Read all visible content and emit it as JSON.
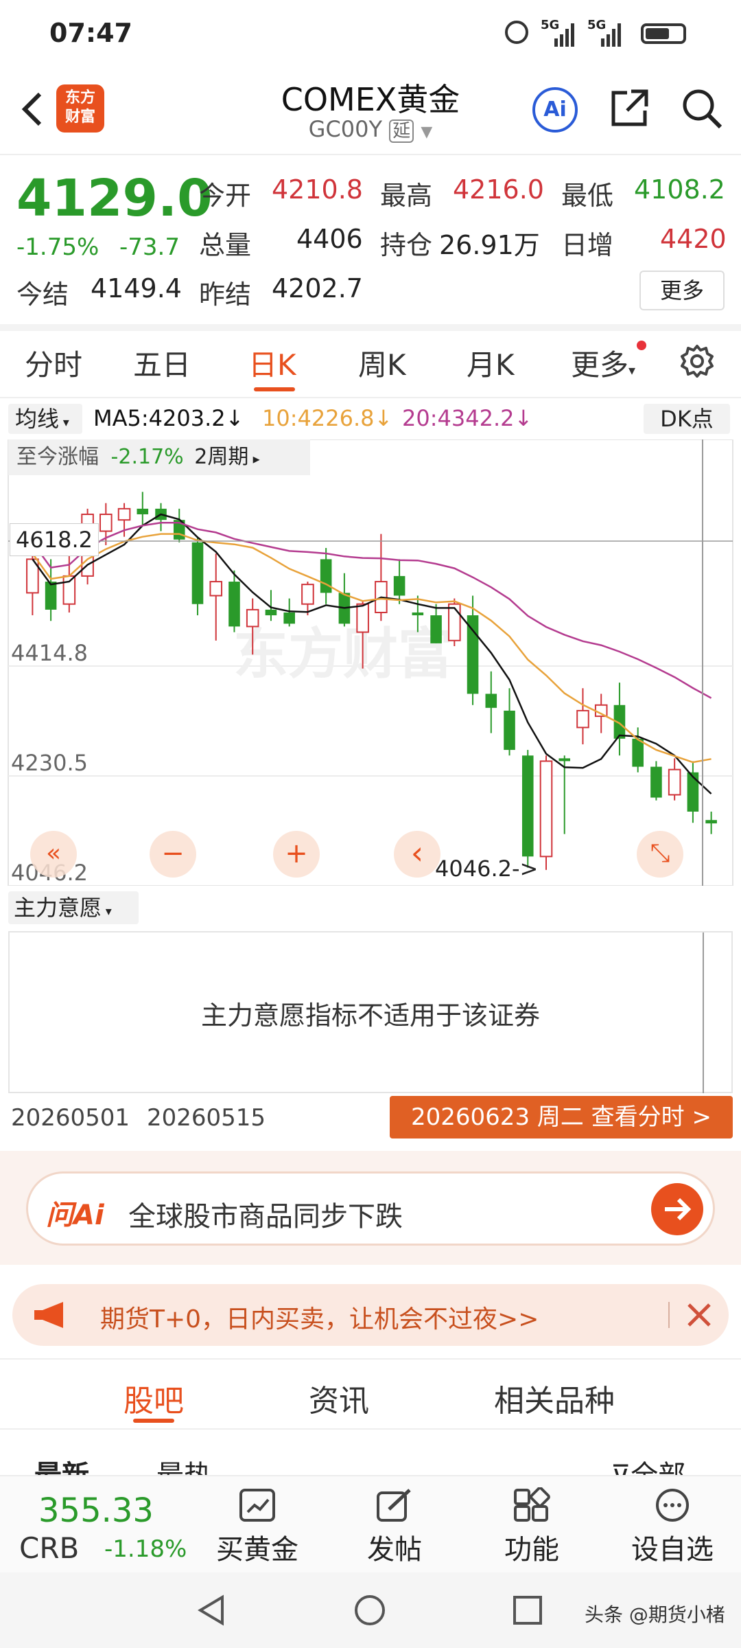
{
  "status": {
    "time": "07:47",
    "network_1": "5G",
    "network_2": "5G"
  },
  "header": {
    "logo_line1": "东方",
    "logo_line2": "财富",
    "title": "COMEX黄金",
    "code": "GC00Y",
    "delay_tag": "延",
    "ai_label": "Ai"
  },
  "quote": {
    "price": "4129.0",
    "change_pct": "-1.75%",
    "change": "-73.7",
    "open_label": "今开",
    "open": "4210.8",
    "high_label": "最高",
    "high": "4216.0",
    "low_label": "最低",
    "low": "4108.2",
    "volume_label": "总量",
    "volume": "4406",
    "oi_label": "持仓",
    "oi": "26.91万",
    "daily_inc_label": "日增",
    "daily_inc": "4420",
    "settle_label": "今结",
    "settle": "4149.4",
    "prev_settle_label": "昨结",
    "prev_settle": "4202.7",
    "more_label": "更多"
  },
  "tabs": [
    "分时",
    "五日",
    "日K",
    "周K",
    "月K",
    "更多"
  ],
  "indicator_bar": {
    "ma_select": "均线",
    "ma5": "MA5:4203.2",
    "ma10": "10:4226.8",
    "ma20": "20:4342.2",
    "dk": "DK点"
  },
  "chart_data": {
    "type": "candlestick",
    "period_change_label": "至今涨幅",
    "period_change": "-2.17%",
    "period_length": "2周期",
    "crosshair_price": "4618.2",
    "y_ticks": [
      "4414.8",
      "4230.5",
      "4046.2"
    ],
    "min_marker": "4046.2->",
    "x_labels": [
      "20260501",
      "20260515"
    ],
    "series": [
      {
        "name": "MA5",
        "color": "#111111"
      },
      {
        "name": "MA10",
        "color": "#e8a23a"
      },
      {
        "name": "MA20",
        "color": "#b43b8f"
      }
    ],
    "candles": [
      {
        "o": 4540,
        "h": 4650,
        "l": 4500,
        "c": 4600
      },
      {
        "o": 4560,
        "h": 4600,
        "l": 4490,
        "c": 4510
      },
      {
        "o": 4520,
        "h": 4610,
        "l": 4505,
        "c": 4570
      },
      {
        "o": 4570,
        "h": 4690,
        "l": 4555,
        "c": 4680
      },
      {
        "o": 4650,
        "h": 4700,
        "l": 4625,
        "c": 4680
      },
      {
        "o": 4670,
        "h": 4700,
        "l": 4640,
        "c": 4690
      },
      {
        "o": 4690,
        "h": 4720,
        "l": 4660,
        "c": 4680
      },
      {
        "o": 4690,
        "h": 4700,
        "l": 4650,
        "c": 4670
      },
      {
        "o": 4670,
        "h": 4690,
        "l": 4630,
        "c": 4635
      },
      {
        "o": 4630,
        "h": 4640,
        "l": 4500,
        "c": 4520
      },
      {
        "o": 4535,
        "h": 4610,
        "l": 4455,
        "c": 4560
      },
      {
        "o": 4560,
        "h": 4580,
        "l": 4470,
        "c": 4480
      },
      {
        "o": 4480,
        "h": 4530,
        "l": 4430,
        "c": 4510
      },
      {
        "o": 4510,
        "h": 4545,
        "l": 4490,
        "c": 4500
      },
      {
        "o": 4505,
        "h": 4530,
        "l": 4480,
        "c": 4485
      },
      {
        "o": 4520,
        "h": 4560,
        "l": 4500,
        "c": 4555
      },
      {
        "o": 4600,
        "h": 4620,
        "l": 4520,
        "c": 4540
      },
      {
        "o": 4540,
        "h": 4575,
        "l": 4480,
        "c": 4485
      },
      {
        "o": 4470,
        "h": 4525,
        "l": 4405,
        "c": 4520
      },
      {
        "o": 4505,
        "h": 4645,
        "l": 4490,
        "c": 4560
      },
      {
        "o": 4570,
        "h": 4600,
        "l": 4520,
        "c": 4535
      },
      {
        "o": 4505,
        "h": 4535,
        "l": 4470,
        "c": 4500
      },
      {
        "o": 4500,
        "h": 4520,
        "l": 4450,
        "c": 4450
      },
      {
        "o": 4455,
        "h": 4530,
        "l": 4445,
        "c": 4520
      },
      {
        "o": 4500,
        "h": 4535,
        "l": 4340,
        "c": 4360
      },
      {
        "o": 4360,
        "h": 4400,
        "l": 4290,
        "c": 4335
      },
      {
        "o": 4330,
        "h": 4370,
        "l": 4250,
        "c": 4260
      },
      {
        "o": 4250,
        "h": 4260,
        "l": 4050,
        "c": 4070
      },
      {
        "o": 4070,
        "h": 4250,
        "l": 4046,
        "c": 4240
      },
      {
        "o": 4245,
        "h": 4250,
        "l": 4110,
        "c": 4240
      },
      {
        "o": 4300,
        "h": 4370,
        "l": 4270,
        "c": 4330
      },
      {
        "o": 4320,
        "h": 4360,
        "l": 4290,
        "c": 4340
      },
      {
        "o": 4340,
        "h": 4380,
        "l": 4250,
        "c": 4280
      },
      {
        "o": 4280,
        "h": 4300,
        "l": 4220,
        "c": 4230
      },
      {
        "o": 4230,
        "h": 4240,
        "l": 4170,
        "c": 4175
      },
      {
        "o": 4180,
        "h": 4245,
        "l": 4170,
        "c": 4225
      },
      {
        "o": 4220,
        "h": 4240,
        "l": 4130,
        "c": 4150
      },
      {
        "o": 4135,
        "h": 4150,
        "l": 4110,
        "c": 4129
      }
    ]
  },
  "chart_controls": {
    "first": "«",
    "zoom_out": "−",
    "zoom_in": "+",
    "prev": "‹",
    "expand": "⤡"
  },
  "sub_indicator": {
    "select": "主力意愿",
    "message": "主力意愿指标不适用于该证券"
  },
  "date_bar": {
    "date_info": "20260623 周二 查看分时 >"
  },
  "ai_box": {
    "brand": "问Ai",
    "query": "全球股市商品同步下跌"
  },
  "promo": {
    "text": "期货T+0，日内买卖，让机会不过夜>>"
  },
  "content_tabs": [
    "股吧",
    "资讯",
    "相关品种"
  ],
  "feed_filters": {
    "latest": "最新",
    "hot": "最热",
    "all": "全部"
  },
  "bottom_bar": {
    "index_value": "355.33",
    "index_name": "CRB",
    "index_change": "-1.18%",
    "buy_gold": "买黄金",
    "post": "发帖",
    "functions": "功能",
    "add_watch": "设自选"
  },
  "watermark": "东方财富",
  "attribution": "头条 @期货小楮"
}
